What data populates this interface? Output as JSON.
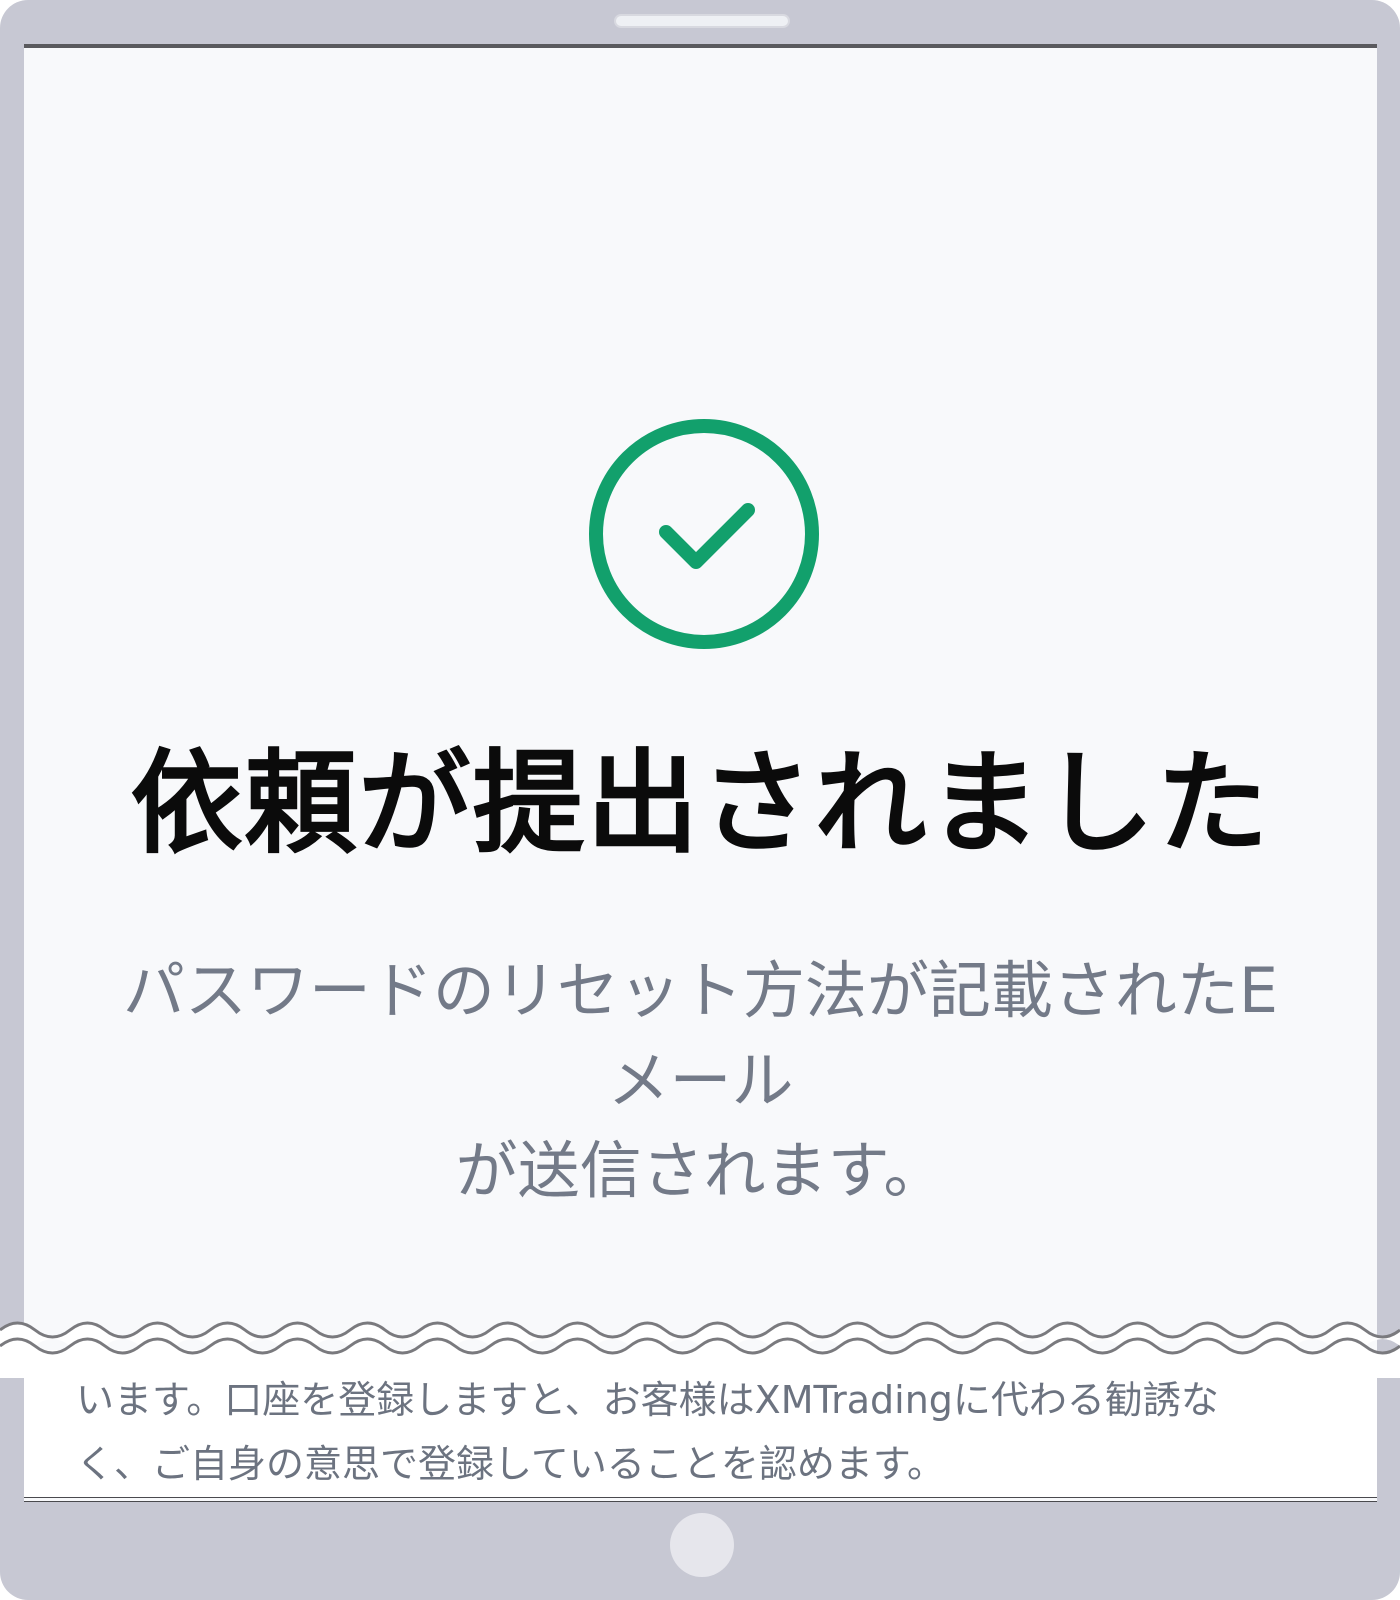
{
  "status": {
    "title": "依頼が提出されました",
    "description_line1": "パスワードのリセット方法が記載されたEメール",
    "description_line2": "が送信されます。",
    "icon": "check-circle-icon",
    "accent_color": "#12a06c"
  },
  "fine_print": {
    "line1": "います。口座を登録しますと、お客様はXMTradingに代わる勧誘な",
    "line2": "く、ご自身の意思で登録していることを認めます。"
  }
}
